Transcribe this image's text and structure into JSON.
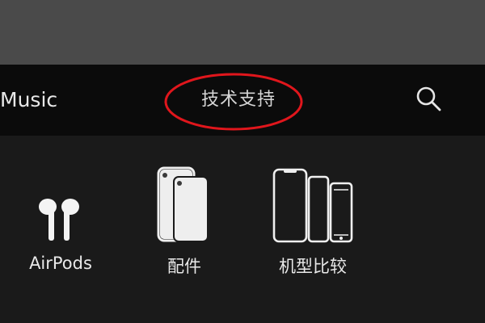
{
  "navbar": {
    "music_label": "Music",
    "support_label": "技术支持",
    "search_icon": "search-icon"
  },
  "annotation": {
    "color": "#e0161c"
  },
  "products": [
    {
      "label": "AirPods",
      "icon": "airpods-icon"
    },
    {
      "label": "配件",
      "icon": "accessories-icon"
    },
    {
      "label": "机型比较",
      "icon": "compare-models-icon"
    }
  ],
  "colors": {
    "top_band": "#4a4a4a",
    "navbar_bg": "#0b0b0b",
    "content_bg": "#1a1a1a",
    "text": "#e9e9e9"
  }
}
